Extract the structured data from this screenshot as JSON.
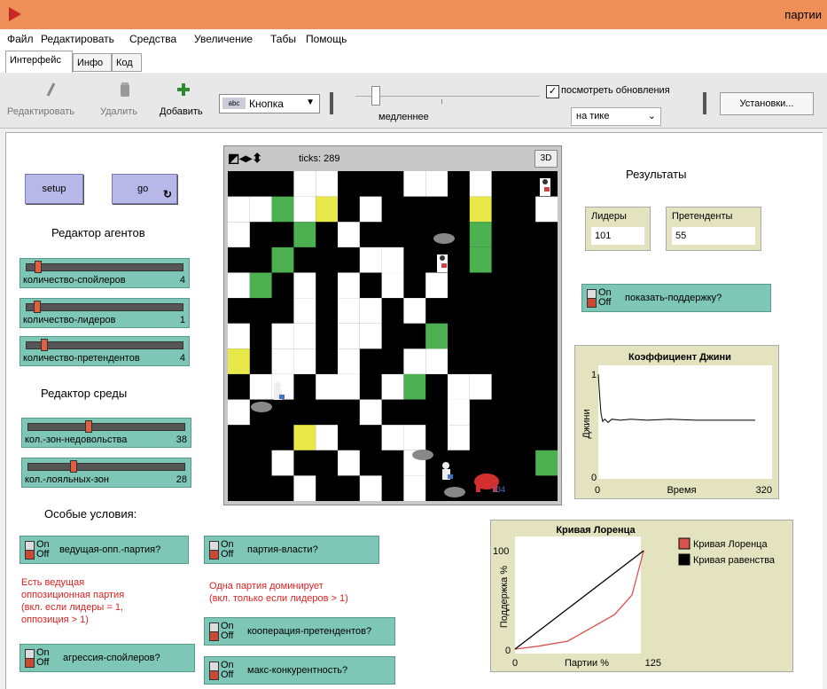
{
  "window": {
    "title": "партии"
  },
  "menu": [
    "Файл",
    "Редактировать",
    "Средства",
    "Увеличение",
    "Табы",
    "Помощь"
  ],
  "tabs": [
    "Интерфейс",
    "Инфо",
    "Код"
  ],
  "toolbar": {
    "edit": "Редактировать",
    "delete": "Удалить",
    "add": "Добавить",
    "widget_type": "Кнопка",
    "speed_label": "медленнее",
    "view_updates": "посмотреть обновления",
    "view_updates_checked": true,
    "update_mode": "на тике",
    "settings": "Установки..."
  },
  "buttons": {
    "setup": "setup",
    "go": "go"
  },
  "headings": {
    "agents": "Редактор агентов",
    "environment": "Редактор среды",
    "special": "Особые условия:",
    "results": "Результаты"
  },
  "sliders": [
    {
      "label": "количество-спойлеров",
      "value": "4",
      "fraction": 0.06
    },
    {
      "label": "количество-лидеров",
      "value": "1",
      "fraction": 0.05
    },
    {
      "label": "количество-претендентов",
      "value": "4",
      "fraction": 0.1
    },
    {
      "label": "кол.-зон-недовольства",
      "value": "38",
      "fraction": 0.38
    },
    {
      "label": "кол.-лояльных-зон",
      "value": "28",
      "fraction": 0.28
    }
  ],
  "switch_state": {
    "on": "On",
    "off": "Off"
  },
  "switches": {
    "support": "показать-поддержку?",
    "leading_opp": "ведущая-опп.-партия?",
    "power_party": "партия-власти?",
    "cooperation": "кооперация-претендентов?",
    "aggression": "агрессия-спойлеров?",
    "max_compet": "макс-конкурентность?"
  },
  "notes": {
    "leading_opp": "Есть ведущая\nоппозиционная партия\n(вкл. если лидеры = 1,\nоппозиция > 1)",
    "power_party": "Одна партия доминирует\n(вкл. только если лидеров > 1)"
  },
  "world": {
    "ticks": "ticks: 289",
    "btn3d": "3D",
    "agent_label": "134"
  },
  "monitors": {
    "leaders": {
      "label": "Лидеры",
      "value": "101"
    },
    "contenders": {
      "label": "Претенденты",
      "value": "55"
    }
  },
  "colors": {
    "button": "#b7b7e8",
    "widget": "#7ec6b6",
    "plot_bg": "#e3e3c0",
    "lorenz": "#d9534f",
    "equality": "#000000"
  },
  "chart_data": [
    {
      "type": "line",
      "title": "Коэффициент Джини",
      "xlabel": "Время",
      "ylabel": "Джини",
      "xlim": [
        0,
        320
      ],
      "ylim": [
        0,
        1
      ],
      "x_tick_labels": [
        "0",
        "320"
      ],
      "y_tick_labels": [
        "0",
        "1"
      ],
      "series": [
        {
          "x": [
            0,
            3,
            5,
            8,
            12,
            18,
            25,
            40,
            60,
            90,
            130,
            180,
            230,
            280,
            289
          ],
          "y": [
            1.0,
            0.76,
            0.62,
            0.55,
            0.57,
            0.54,
            0.57,
            0.56,
            0.57,
            0.56,
            0.57,
            0.56,
            0.56,
            0.56,
            0.56
          ]
        }
      ]
    },
    {
      "type": "line",
      "title": "Кривая Лоренца",
      "xlabel": "Партии %",
      "ylabel": "Поддержка %",
      "xlim": [
        0,
        125
      ],
      "ylim": [
        0,
        100
      ],
      "x_tick_labels": [
        "0",
        "125"
      ],
      "y_tick_labels": [
        "0",
        "100"
      ],
      "legend": "right",
      "series": [
        {
          "name": "Кривая Лоренца",
          "color": "#d9534f",
          "x": [
            0,
            20,
            45,
            85,
            100,
            110
          ],
          "y": [
            0,
            3,
            8,
            35,
            55,
            100
          ]
        },
        {
          "name": "Кривая равенства",
          "color": "#000000",
          "x": [
            0,
            110
          ],
          "y": [
            0,
            100
          ]
        }
      ]
    }
  ]
}
